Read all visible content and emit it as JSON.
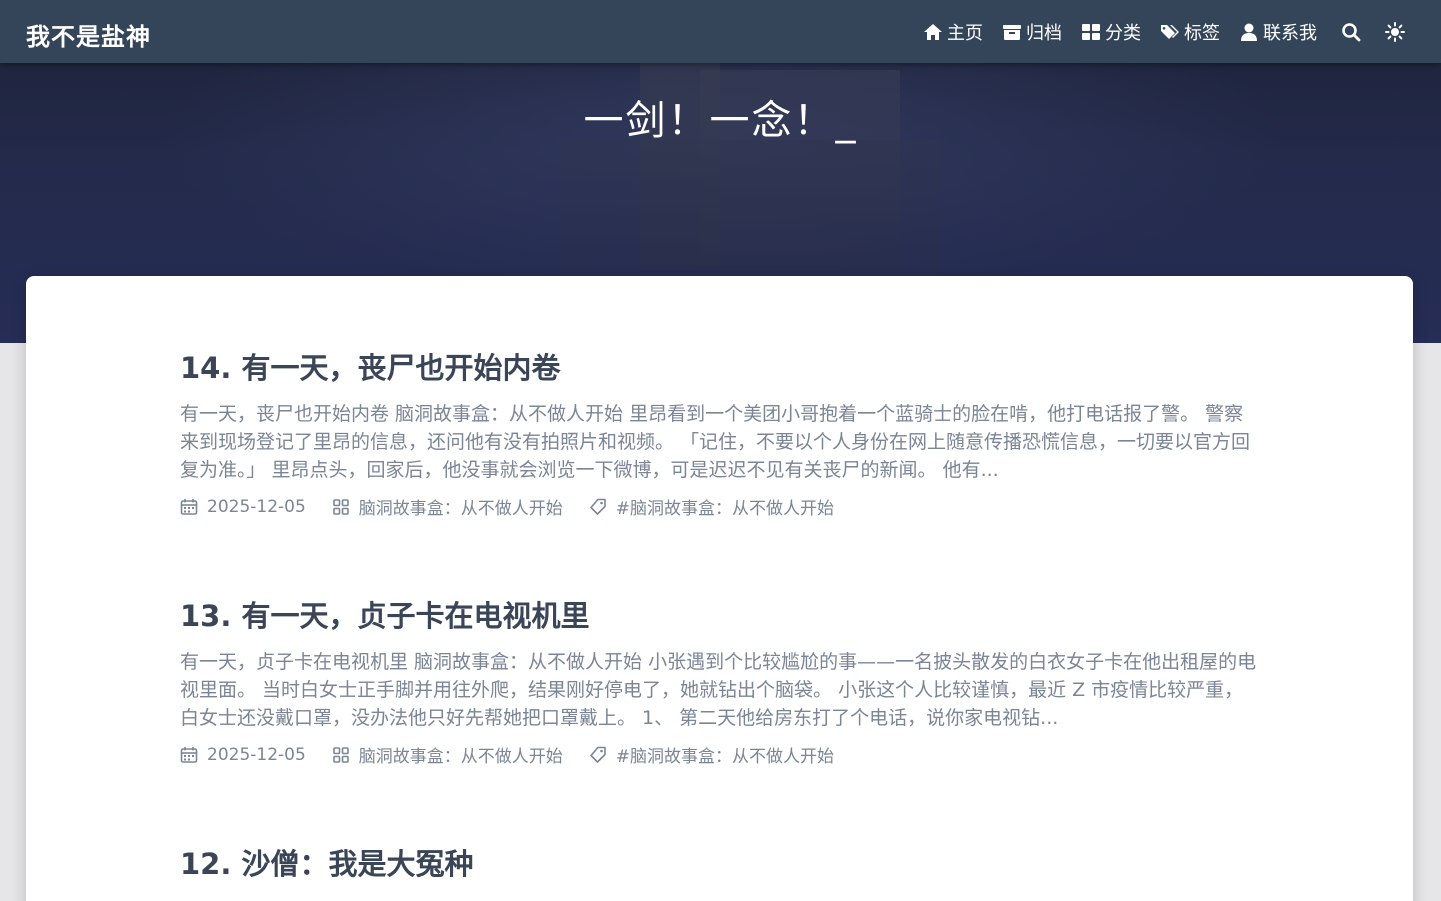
{
  "site": {
    "brand": "我不是盐神"
  },
  "nav": {
    "items": [
      {
        "label": "主页",
        "icon": "home-icon"
      },
      {
        "label": "归档",
        "icon": "archive-icon"
      },
      {
        "label": "分类",
        "icon": "category-icon"
      },
      {
        "label": "标签",
        "icon": "tags-icon"
      },
      {
        "label": "联系我",
        "icon": "user-icon"
      }
    ],
    "search_icon": "search-icon",
    "theme_icon": "sun-icon"
  },
  "hero": {
    "title": "一剑！一念！_"
  },
  "posts": [
    {
      "title": "14. 有一天，丧尸也开始内卷",
      "excerpt": "有一天，丧尸也开始内卷 脑洞故事盒：从不做人开始 里昂看到一个美团小哥抱着一个蓝骑士的脸在啃，他打电话报了警。 警察来到现场登记了里昂的信息，还问他有没有拍照片和视频。 「记住，不要以个人身份在网上随意传播恐慌信息，一切要以官方回复为准。」 里昂点头，回家后，他没事就会浏览一下微博，可是迟迟不见有关丧尸的新闻。 他有...",
      "date": "2025-12-05",
      "category": "脑洞故事盒：从不做人开始",
      "tag": "#脑洞故事盒：从不做人开始"
    },
    {
      "title": "13. 有一天，贞子卡在电视机里",
      "excerpt": "有一天，贞子卡在电视机里 脑洞故事盒：从不做人开始 小张遇到个比较尴尬的事——一名披头散发的白衣女子卡在他出租屋的电视里面。 当时白女士正手脚并用往外爬，结果刚好停电了，她就钻出个脑袋。 小张这个人比较谨慎，最近 Z 市疫情比较严重，白女士还没戴口罩，没办法他只好先帮她把口罩戴上。 1、 第二天他给房东打了个电话，说你家电视钻...",
      "date": "2025-12-05",
      "category": "脑洞故事盒：从不做人开始",
      "tag": "#脑洞故事盒：从不做人开始"
    },
    {
      "title": "12. 沙僧：我是大冤种"
    }
  ]
}
